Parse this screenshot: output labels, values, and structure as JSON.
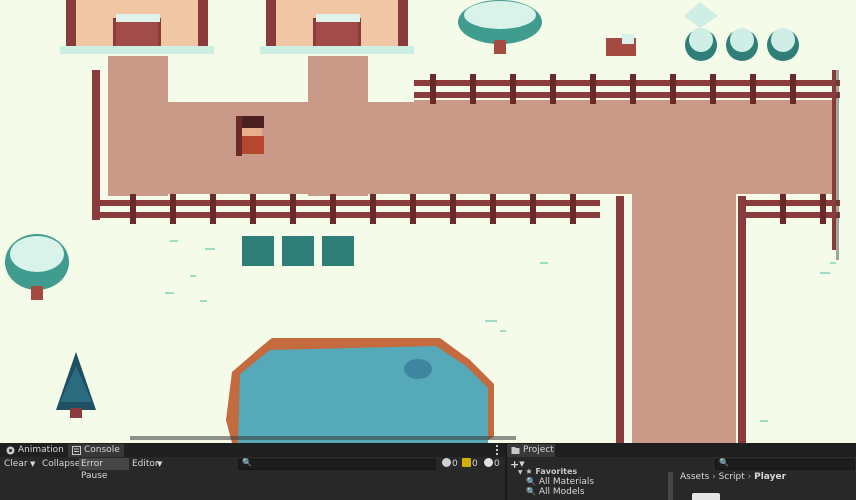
{
  "scene": {
    "colors": {
      "snow": "#f4fbe9",
      "path": "#c89a87",
      "fence": "#8a3b3b",
      "water": "#55a9b8",
      "shore": "#c46a3f",
      "tree_teal": "#2f7f78",
      "roof_house": "#f1c6a4"
    }
  },
  "console_panel": {
    "tabs": [
      {
        "label": "Animation",
        "icon": "animation-icon"
      },
      {
        "label": "Console",
        "icon": "console-icon"
      }
    ],
    "menu_icon": "kebab-menu-icon",
    "toolbar": {
      "clear": "Clear",
      "collapse": "Collapse",
      "error_pause": "Error Pause",
      "editor": "Editor"
    },
    "counts": {
      "info": "0",
      "warn": "0",
      "error": "0"
    }
  },
  "project_panel": {
    "tab_label": "Project",
    "add_label": "+",
    "favorites_label": "Favorites",
    "favorites": [
      "All Materials",
      "All Models"
    ],
    "breadcrumb": [
      "Assets",
      "Script",
      "Player"
    ]
  }
}
